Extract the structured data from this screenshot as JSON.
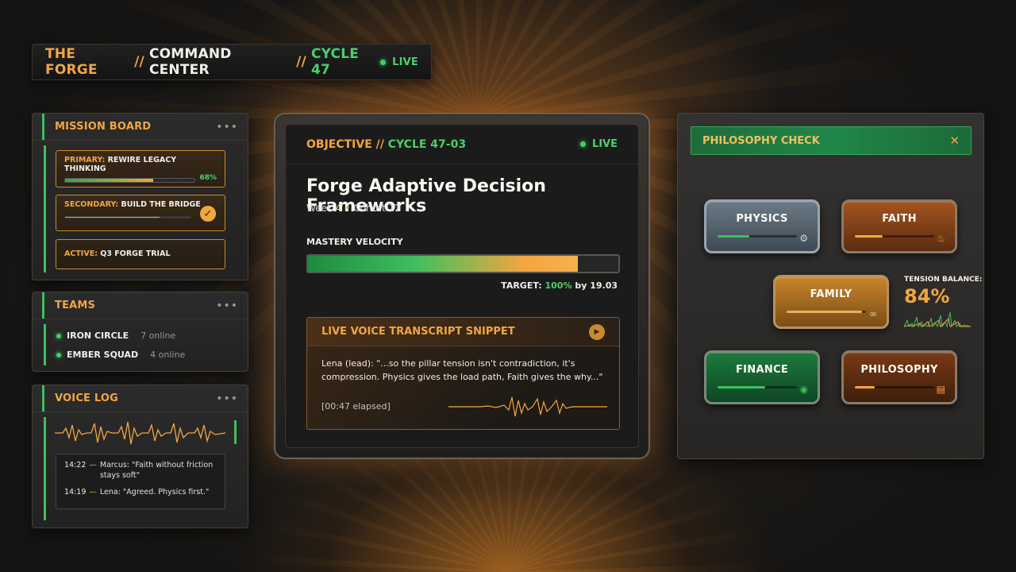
{
  "header": {
    "brand": "THE FORGE",
    "sep": "//",
    "section": "COMMAND CENTER",
    "cycle": "CYCLE 47",
    "live": "LIVE"
  },
  "mission_board": {
    "title": "MISSION BOARD",
    "more": "•••",
    "primary": {
      "key": "PRIMARY:",
      "text": "REWIRE LEGACY THINKING",
      "progress_pct": 68,
      "pct_label": "68%"
    },
    "secondary": {
      "key": "SECONDARY:",
      "text": "BUILD THE BRIDGE",
      "progress_pct": 75,
      "check": "✓"
    },
    "active": {
      "key": "ACTIVE:",
      "text": "Q3 FORGE TRIAL"
    }
  },
  "teams": {
    "title": "TEAMS",
    "more": "•••",
    "items": [
      {
        "name": "IRON CIRCLE",
        "count": "7 online"
      },
      {
        "name": "EMBER SQUAD",
        "count": "4 online"
      }
    ]
  },
  "voice_log": {
    "title": "VOICE LOG",
    "more": "•••",
    "entries": [
      {
        "time": "14:22",
        "dash": "—",
        "text": "Marcus: \"Faith without friction stays soft\""
      },
      {
        "time": "14:19",
        "dash": "—",
        "text": "Lena: \"Agreed. Physics first.\""
      }
    ]
  },
  "objective": {
    "label": "OBJECTIVE",
    "sep": "//",
    "cycle": "CYCLE 47-03",
    "live": "LIVE",
    "title": "Forge Adaptive Decision Frameworks",
    "week": "Week 4",
    "bullet": "•",
    "cohort": "Cohort 12",
    "mastery_label": "MASTERY VELOCITY",
    "mastery_pct": 87,
    "target_prefix": "TARGET:",
    "target_value": "100%",
    "target_suffix": "by 19.03",
    "transcript": {
      "title": "LIVE VOICE TRANSCRIPT SNIPPET",
      "text": "Lena (lead): \"...so the pillar tension isn't contradiction, it's compression. Physics gives the load path, Faith gives the why...\"",
      "elapsed": "[00:47 elapsed]"
    }
  },
  "philosophy_check": {
    "title": "PHILOSOPHY CHECK",
    "tool_icon": "tools-icon",
    "pillars": [
      {
        "name": "PHYSICS",
        "fill_pct": 40,
        "icon": "gear-icon"
      },
      {
        "name": "FAITH",
        "fill_pct": 35,
        "icon": "flame-icon"
      },
      {
        "name": "FAMILY",
        "fill_pct": 95,
        "icon": "link-icon"
      },
      {
        "name": "FINANCE",
        "fill_pct": 60,
        "icon": "coins-icon"
      },
      {
        "name": "PHILOSOPHY",
        "fill_pct": 25,
        "icon": "book-icon"
      }
    ],
    "tension_label": "TENSION BALANCE:",
    "tension_value": "84%"
  },
  "colors": {
    "accent_orange": "#f2a640",
    "accent_green": "#3fbf5e"
  }
}
